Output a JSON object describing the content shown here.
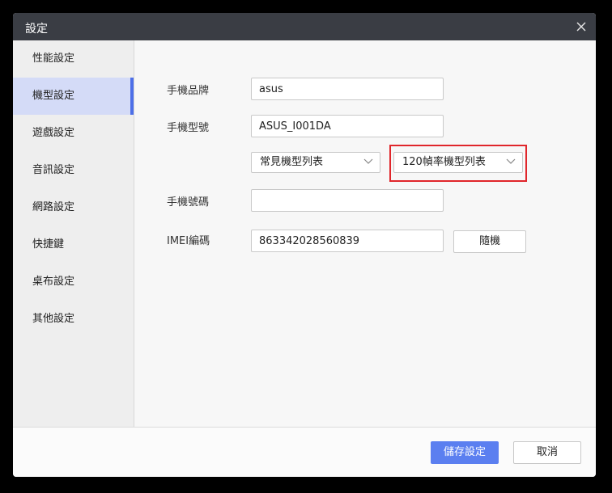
{
  "window": {
    "title": "設定"
  },
  "sidebar": {
    "items": [
      {
        "label": "性能設定"
      },
      {
        "label": "機型設定"
      },
      {
        "label": "遊戲設定"
      },
      {
        "label": "音訊設定"
      },
      {
        "label": "網路設定"
      },
      {
        "label": "快捷鍵"
      },
      {
        "label": "桌布設定"
      },
      {
        "label": "其他設定"
      }
    ],
    "active_index": 1
  },
  "form": {
    "brand_label": "手機品牌",
    "brand_value": "asus",
    "model_label": "手機型號",
    "model_value": "ASUS_I001DA",
    "common_models_select": "常見機型列表",
    "fps120_models_select": "120幀率機型列表",
    "phone_number_label": "手機號碼",
    "phone_number_value": "",
    "imei_label": "IMEI編碼",
    "imei_value": "863342028560839",
    "random_button": "隨機"
  },
  "footer": {
    "save_label": "儲存設定",
    "cancel_label": "取消"
  },
  "colors": {
    "titlebar": "#3a3d44",
    "accent": "#5b7ff0",
    "active_item_bg": "#d4dbf7",
    "highlight_box": "#e0262b"
  }
}
